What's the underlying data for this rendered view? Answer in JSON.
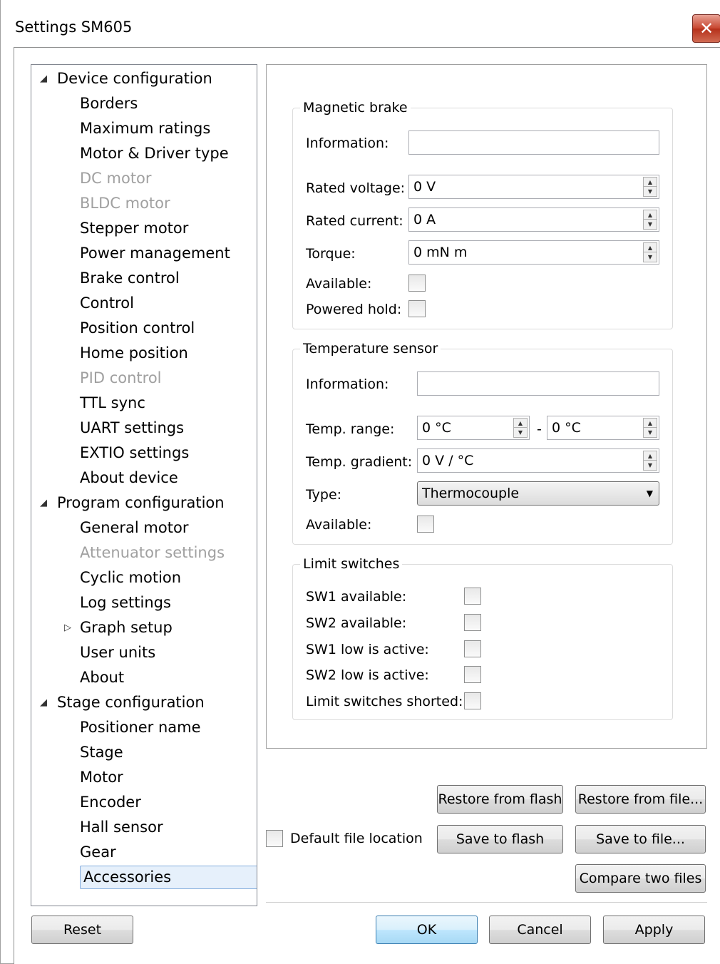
{
  "window": {
    "title": "Settings SM605",
    "close_label": "✕"
  },
  "tree": {
    "items": [
      {
        "label": "Device configuration",
        "level": 0,
        "expander": "◢",
        "state": "normal"
      },
      {
        "label": "Borders",
        "level": 1,
        "state": "normal"
      },
      {
        "label": "Maximum ratings",
        "level": 1,
        "state": "normal"
      },
      {
        "label": "Motor & Driver type",
        "level": 1,
        "state": "normal"
      },
      {
        "label": "DC motor",
        "level": 1,
        "state": "disabled"
      },
      {
        "label": "BLDC motor",
        "level": 1,
        "state": "disabled"
      },
      {
        "label": "Stepper motor",
        "level": 1,
        "state": "normal"
      },
      {
        "label": "Power management",
        "level": 1,
        "state": "normal"
      },
      {
        "label": "Brake control",
        "level": 1,
        "state": "normal"
      },
      {
        "label": "Control",
        "level": 1,
        "state": "normal"
      },
      {
        "label": "Position control",
        "level": 1,
        "state": "normal"
      },
      {
        "label": "Home position",
        "level": 1,
        "state": "normal"
      },
      {
        "label": "PID control",
        "level": 1,
        "state": "disabled"
      },
      {
        "label": "TTL sync",
        "level": 1,
        "state": "normal"
      },
      {
        "label": "UART settings",
        "level": 1,
        "state": "normal"
      },
      {
        "label": "EXTIO settings",
        "level": 1,
        "state": "normal"
      },
      {
        "label": "About device",
        "level": 1,
        "state": "normal"
      },
      {
        "label": "Program configuration",
        "level": 0,
        "expander": "◢",
        "state": "normal"
      },
      {
        "label": "General motor",
        "level": 1,
        "state": "normal"
      },
      {
        "label": "Attenuator settings",
        "level": 1,
        "state": "disabled"
      },
      {
        "label": "Cyclic motion",
        "level": 1,
        "state": "normal"
      },
      {
        "label": "Log settings",
        "level": 1,
        "state": "normal"
      },
      {
        "label": "Graph setup",
        "level": 1,
        "expander": "▷",
        "state": "normal"
      },
      {
        "label": "User units",
        "level": 1,
        "state": "normal"
      },
      {
        "label": "About",
        "level": 1,
        "state": "normal"
      },
      {
        "label": "Stage configuration",
        "level": 0,
        "expander": "◢",
        "state": "normal"
      },
      {
        "label": "Positioner name",
        "level": 1,
        "state": "normal"
      },
      {
        "label": "Stage",
        "level": 1,
        "state": "normal"
      },
      {
        "label": "Motor",
        "level": 1,
        "state": "normal"
      },
      {
        "label": "Encoder",
        "level": 1,
        "state": "normal"
      },
      {
        "label": "Hall sensor",
        "level": 1,
        "state": "normal"
      },
      {
        "label": "Gear",
        "level": 1,
        "state": "normal"
      },
      {
        "label": "Accessories",
        "level": 1,
        "state": "selected"
      }
    ]
  },
  "magnetic_brake": {
    "title": "Magnetic brake",
    "information_label": "Information:",
    "information_value": "",
    "rated_voltage_label": "Rated voltage:",
    "rated_voltage_value": "0 V",
    "rated_current_label": "Rated current:",
    "rated_current_value": "0 A",
    "torque_label": "Torque:",
    "torque_value": "0 mN m",
    "available_label": "Available:",
    "powered_hold_label": "Powered hold:"
  },
  "temperature_sensor": {
    "title": "Temperature sensor",
    "information_label": "Information:",
    "information_value": "",
    "temp_range_label": "Temp. range:",
    "temp_range_min": "0 °C",
    "temp_range_sep": "-",
    "temp_range_max": "0 °C",
    "temp_gradient_label": "Temp. gradient:",
    "temp_gradient_value": "0 V / °C",
    "type_label": "Type:",
    "type_value": "Thermocouple",
    "available_label": "Available:"
  },
  "limit_switches": {
    "title": "Limit switches",
    "sw1_available_label": "SW1 available:",
    "sw2_available_label": "SW2 available:",
    "sw1_low_label": "SW1 low is active:",
    "sw2_low_label": "SW2 low is active:",
    "shorted_label": "Limit switches shorted:"
  },
  "file_actions": {
    "default_location_label": "Default file location",
    "restore_flash": "Restore from flash",
    "restore_file": "Restore from file...",
    "save_flash": "Save to flash",
    "save_file": "Save to file...",
    "compare_files": "Compare two files"
  },
  "footer": {
    "reset": "Reset",
    "ok": "OK",
    "cancel": "Cancel",
    "apply": "Apply"
  }
}
